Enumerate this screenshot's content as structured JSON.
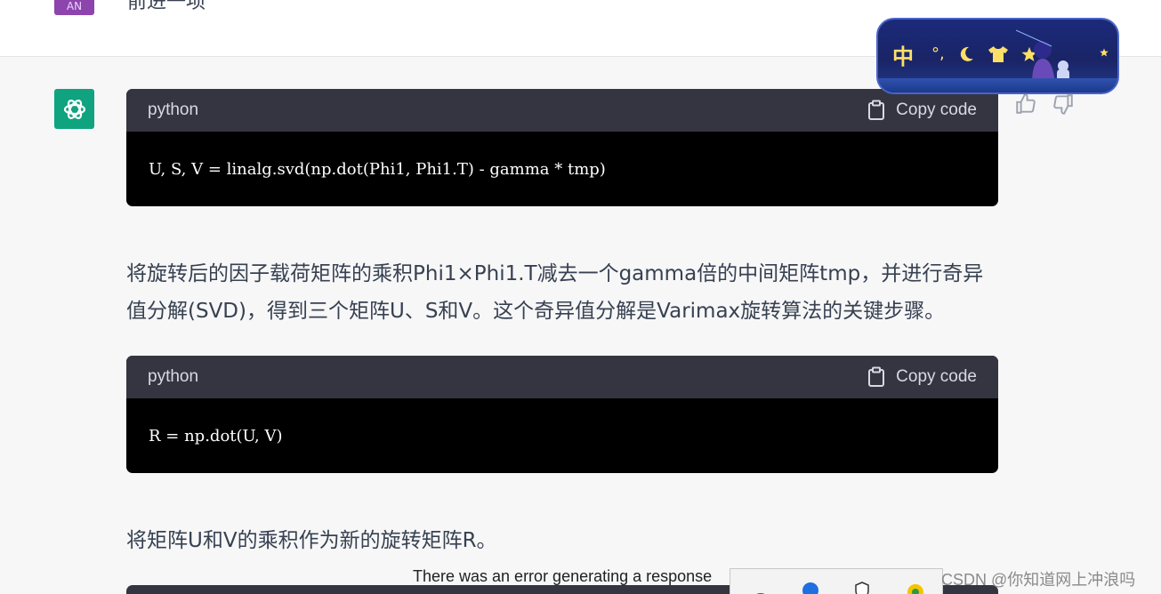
{
  "previous_message": {
    "avatar_text": "AN",
    "text": "前进一项"
  },
  "assistant": {
    "avatar_icon": "openai-logo-icon"
  },
  "code_blocks": [
    {
      "language": "python",
      "copy_label": "Copy code",
      "code": "U, S, V = linalg.svd(np.dot(Phi1, Phi1.T) - gamma * tmp)"
    },
    {
      "language": "python",
      "copy_label": "Copy code",
      "code": "R = np.dot(U, V)"
    }
  ],
  "paragraphs": [
    "将旋转后的因子载荷矩阵的乘积Phi1×Phi1.T减去一个gamma倍的中间矩阵tmp，并进行奇异值分解(SVD)，得到三个矩阵U、S和V。这个奇异值分解是Varimax旋转算法的关键步骤。",
    "将矩阵U和V的乘积作为新的旋转矩阵R。"
  ],
  "feedback": {
    "thumbs_up": "thumbs-up-icon",
    "thumbs_down": "thumbs-down-icon"
  },
  "ime_banner": {
    "mode_label": "中",
    "colors": {
      "bg": "#1a2466",
      "text": "#ffe066"
    }
  },
  "error_message": "There was an error generating a response",
  "watermark": "CSDN @你知道网上冲浪吗",
  "colors": {
    "assistant_avatar": "#10a37f",
    "user_avatar": "#8e44ad",
    "code_header": "#343541",
    "code_bg": "#000000"
  }
}
